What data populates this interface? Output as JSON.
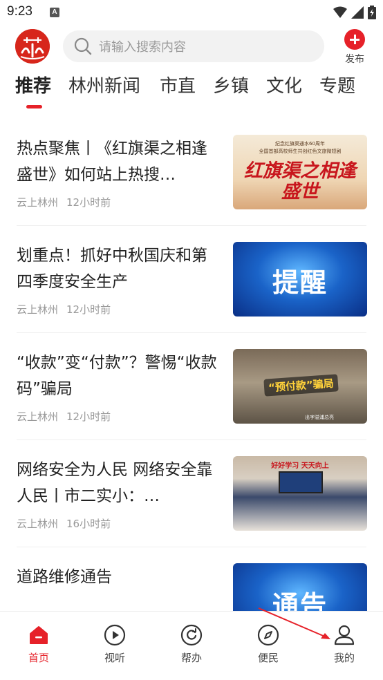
{
  "status_bar": {
    "time": "9:23",
    "badge": "A"
  },
  "header": {
    "search_placeholder": "请输入搜索内容",
    "publish_label": "发布",
    "accent": "#e62129"
  },
  "tabs": [
    {
      "label": "推荐",
      "active": true
    },
    {
      "label": "林州新闻",
      "active": false
    },
    {
      "label": "市直",
      "active": false
    },
    {
      "label": "乡镇",
      "active": false
    },
    {
      "label": "文化",
      "active": false
    },
    {
      "label": "专题",
      "active": false
    }
  ],
  "news": [
    {
      "title": "热点聚焦丨《红旗渠之相逢盛世》如何站上热搜…",
      "source": "云上林州",
      "time": "12小时前",
      "thumb": {
        "small1": "纪念红旗渠通水60周年",
        "small2": "全国首部高校师生共创红色文旅微短剧",
        "big": "红旗渠之相逢盛世"
      }
    },
    {
      "title": "划重点！抓好中秋国庆和第四季度安全生产",
      "source": "云上林州",
      "time": "12小时前",
      "thumb": {
        "big": "提醒"
      }
    },
    {
      "title": "“收款”变“付款”？警惕“收款码”骗局",
      "source": "云上林州",
      "time": "12小时前",
      "thumb": {
        "big": "“预付款”骗局",
        "foot": "出字溢浦总亮"
      }
    },
    {
      "title": "网络安全为人民 网络安全靠人民丨市二实小：…",
      "source": "云上林州",
      "time": "16小时前",
      "thumb": {
        "big": "好好学习 天天向上"
      }
    },
    {
      "title": "道路维修通告",
      "source": "",
      "time": "",
      "thumb": {
        "big": "通告"
      }
    }
  ],
  "bottom_nav": [
    {
      "label": "首页",
      "icon": "home-icon",
      "active": true
    },
    {
      "label": "视听",
      "icon": "play-icon",
      "active": false
    },
    {
      "label": "帮办",
      "icon": "refresh-icon",
      "active": false
    },
    {
      "label": "便民",
      "icon": "compass-icon",
      "active": false
    },
    {
      "label": "我的",
      "icon": "user-icon",
      "active": false
    }
  ]
}
